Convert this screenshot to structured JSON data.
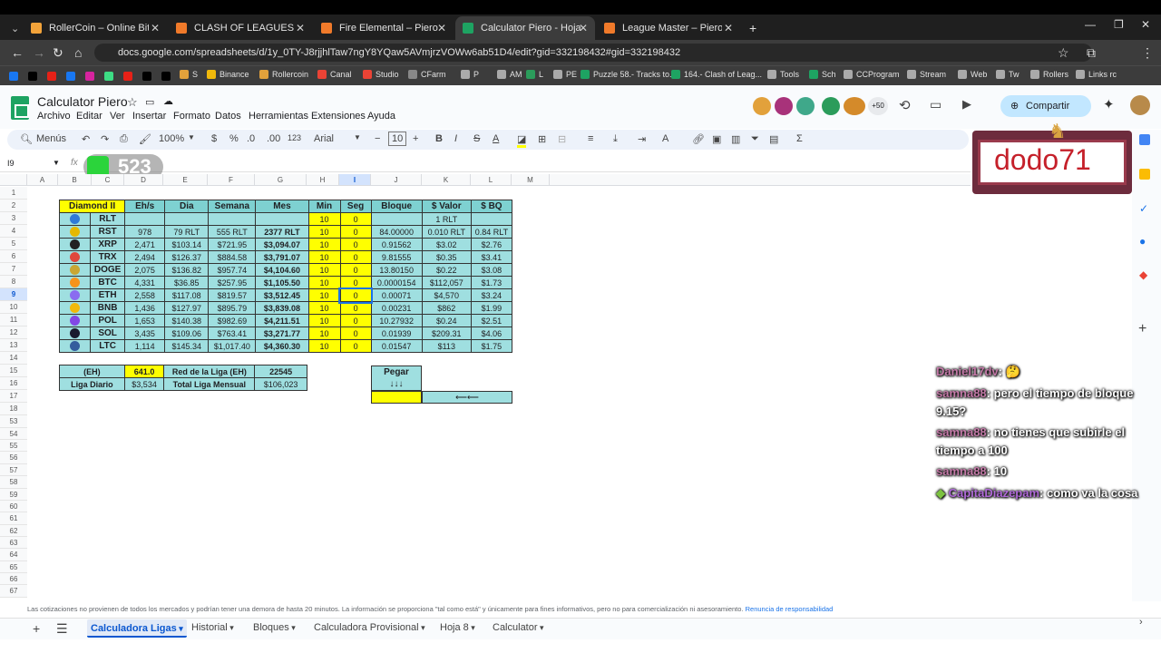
{
  "browser": {
    "tabs": [
      {
        "title": "RollerCoin – Online Bitcoin Min",
        "color": "#f2a33a"
      },
      {
        "title": "CLASH OF LEAGUES – Piero",
        "color": "#f07a2a"
      },
      {
        "title": "Fire Elemental – Piero",
        "color": "#f07a2a"
      },
      {
        "title": "Calculator Piero - Hojas de cálc",
        "color": "#1ea362"
      },
      {
        "title": "League Master – Piero",
        "color": "#f07a2a"
      }
    ],
    "url": "docs.google.com/spreadsheets/d/1y_0TY-J8rjjhlTaw7ngY8YQaw5AVmjrzVOWw6ab51D4/edit?gid=332198432#gid=332198432",
    "bookmarks": [
      "S",
      "Binance",
      "Rollercoin",
      "Canal",
      "Studio",
      "CFarm",
      "P",
      "AM",
      "L",
      "PE",
      "Puzzle 58.- Tracks to...",
      "164.- Clash of Leag...",
      "Tools",
      "Sch",
      "CCProgram",
      "Stream",
      "Web",
      "Tw",
      "Rollers",
      "Links rc"
    ]
  },
  "sheets": {
    "title": "Calculator Piero",
    "menu": [
      "Archivo",
      "Editar",
      "Ver",
      "Insertar",
      "Formato",
      "Datos",
      "Herramientas",
      "Extensiones",
      "Ayuda"
    ],
    "share_label": "Compartir",
    "collab_count": "+50",
    "toolbar": {
      "menus": "Menús",
      "zoom": "100%",
      "currency": "$",
      "percent": "%",
      "dec_less": ".0",
      "dec_more": ".00",
      "num_format": "123",
      "font": "Arial",
      "font_size": "10"
    },
    "cell_ref": "I9",
    "fx": "fx",
    "columns": [
      "A",
      "B",
      "C",
      "D",
      "E",
      "F",
      "G",
      "H",
      "I",
      "J",
      "K",
      "L",
      "M"
    ],
    "rows": [
      "1",
      "2",
      "3",
      "4",
      "5",
      "6",
      "7",
      "8",
      "9",
      "10",
      "11",
      "12",
      "13",
      "14",
      "15",
      "16",
      "17",
      "18",
      "53",
      "54",
      "55",
      "56",
      "57",
      "58",
      "59",
      "60",
      "61",
      "62",
      "63",
      "64",
      "65",
      "66",
      "67"
    ],
    "main_table": {
      "headers": [
        "Diamond II",
        "Eh/s",
        "Dia",
        "Semana",
        "Mes",
        "Min",
        "Seg",
        "Bloque",
        "$ Valor",
        "$ BQ"
      ],
      "rows": [
        {
          "coin": "RLT",
          "color": "#2f7ad8",
          "ehs": "",
          "dia": "",
          "semana": "",
          "mes": "",
          "min": "10",
          "seg": "0",
          "bloque": "",
          "valor": "1 RLT",
          "bq": ""
        },
        {
          "coin": "RST",
          "color": "#e6b800",
          "ehs": "978",
          "dia": "79 RLT",
          "semana": "555 RLT",
          "mes": "2377 RLT",
          "min": "10",
          "seg": "0",
          "bloque": "84.00000",
          "valor": "0.010 RLT",
          "bq": "0.84 RLT"
        },
        {
          "coin": "XRP",
          "color": "#222222",
          "ehs": "2,471",
          "dia": "$103.14",
          "semana": "$721.95",
          "mes": "$3,094.07",
          "min": "10",
          "seg": "0",
          "bloque": "0.91562",
          "valor": "$3.02",
          "bq": "$2.76"
        },
        {
          "coin": "TRX",
          "color": "#e0463c",
          "ehs": "2,494",
          "dia": "$126.37",
          "semana": "$884.58",
          "mes": "$3,791.07",
          "min": "10",
          "seg": "0",
          "bloque": "9.81555",
          "valor": "$0.35",
          "bq": "$3.41"
        },
        {
          "coin": "DOGE",
          "color": "#c9a633",
          "ehs": "2,075",
          "dia": "$136.82",
          "semana": "$957.74",
          "mes": "$4,104.60",
          "min": "10",
          "seg": "0",
          "bloque": "13.80150",
          "valor": "$0.22",
          "bq": "$3.08"
        },
        {
          "coin": "BTC",
          "color": "#f7931a",
          "ehs": "4,331",
          "dia": "$36.85",
          "semana": "$257.95",
          "mes": "$1,105.50",
          "min": "10",
          "seg": "0",
          "bloque": "0.0000154",
          "valor": "$112,057",
          "bq": "$1.73"
        },
        {
          "coin": "ETH",
          "color": "#8a6cf0",
          "ehs": "2,558",
          "dia": "$117.08",
          "semana": "$819.57",
          "mes": "$3,512.45",
          "min": "10",
          "seg": "0",
          "bloque": "0.00071",
          "valor": "$4,570",
          "bq": "$3.24"
        },
        {
          "coin": "BNB",
          "color": "#f0b90b",
          "ehs": "1,436",
          "dia": "$127.97",
          "semana": "$895.79",
          "mes": "$3,839.08",
          "min": "10",
          "seg": "0",
          "bloque": "0.00231",
          "valor": "$862",
          "bq": "$1.99"
        },
        {
          "coin": "POL",
          "color": "#8247e5",
          "ehs": "1,653",
          "dia": "$140.38",
          "semana": "$982.69",
          "mes": "$4,211.51",
          "min": "10",
          "seg": "0",
          "bloque": "10.27932",
          "valor": "$0.24",
          "bq": "$2.51"
        },
        {
          "coin": "SOL",
          "color": "#1a1a2e",
          "ehs": "3,435",
          "dia": "$109.06",
          "semana": "$763.41",
          "mes": "$3,271.77",
          "min": "10",
          "seg": "0",
          "bloque": "0.01939",
          "valor": "$209.31",
          "bq": "$4.06"
        },
        {
          "coin": "LTC",
          "color": "#345d9d",
          "ehs": "1,114",
          "dia": "$145.34",
          "semana": "$1,017.40",
          "mes": "$4,360.30",
          "min": "10",
          "seg": "0",
          "bloque": "0.01547",
          "valor": "$113",
          "bq": "$1.75"
        }
      ]
    },
    "summary": {
      "eh_label": "(EH)",
      "eh_value": "641.0",
      "red_label": "Red de la Liga (EH)",
      "red_value": "22545",
      "liga_diario_label": "Liga Diario",
      "liga_diario_value": "$3,534",
      "total_label": "Total Liga Mensual",
      "total_value": "$106,023"
    },
    "pegar": {
      "label": "Pegar",
      "arrows": "↓↓↓",
      "left_arrow": "⟵⟵"
    },
    "footnote": "Las cotizaciones no provienen de todos los mercados y podrían tener una demora de hasta 20 minutos. La información se proporciona \"tal como está\" y únicamente para fines informativos, pero no para comercialización ni asesoramiento.",
    "footnote_link": "Renuncia de responsabilidad",
    "sheet_tabs": [
      "Calculadora Ligas",
      "Historial",
      "Bloques",
      "Calculadora Provisional",
      "Hoja 8",
      "Calculator"
    ]
  },
  "overlay": {
    "counter": "523",
    "streamer": "dodo71",
    "chat": [
      {
        "user": "Daniel17dv",
        "msg": ": 🤔"
      },
      {
        "user": "samna88",
        "msg": ": pero el tiempo de bloque 9.15?"
      },
      {
        "user": "samna88",
        "msg": ": no tienes que subirle el tiempo a 100"
      },
      {
        "user": "samna88",
        "msg": ": 10"
      },
      {
        "user": "CapitaDiazepam",
        "msg": ": como va la cosa"
      }
    ]
  }
}
